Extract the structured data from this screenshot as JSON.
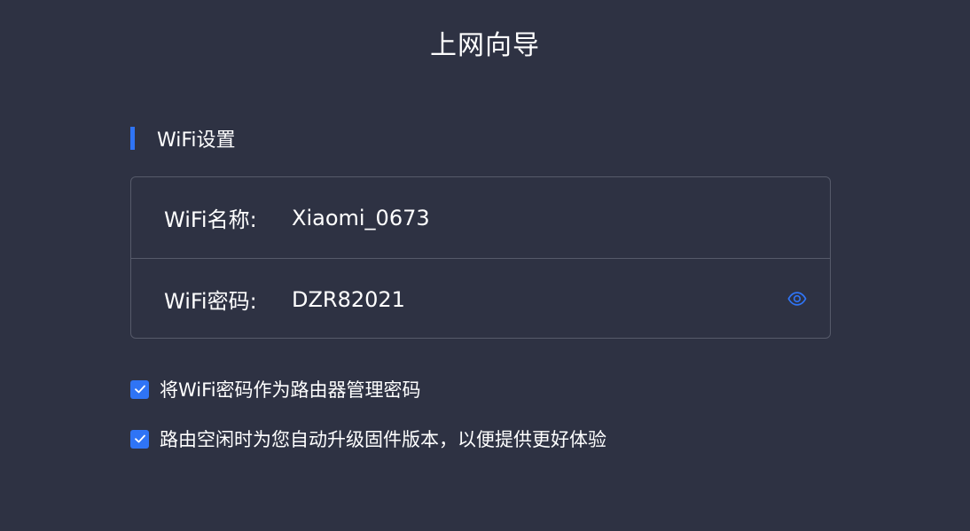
{
  "page": {
    "title": "上网向导"
  },
  "wifi_section": {
    "title": "WiFi设置",
    "name_label": "WiFi名称:",
    "name_value": "Xiaomi_0673",
    "password_label": "WiFi密码:",
    "password_value": "DZR82021",
    "show_password_icon": "eye-icon"
  },
  "options": [
    {
      "label": "将WiFi密码作为路由器管理密码",
      "checked": true
    },
    {
      "label": "路由空闲时为您自动升级固件版本，以便提供更好体验",
      "checked": true
    }
  ],
  "colors": {
    "background": "#2e3243",
    "accent": "#2f74f5",
    "border": "#565a6a",
    "text": "#ffffff"
  }
}
